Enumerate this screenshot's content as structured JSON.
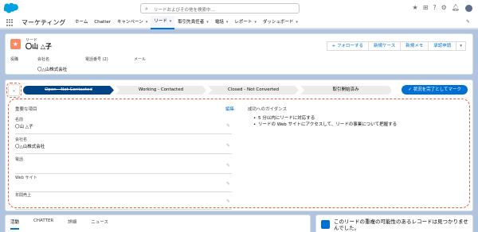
{
  "header": {
    "search_placeholder": "リードおよびその他を検索中..."
  },
  "nav": {
    "app_name": "マーケティング",
    "items": [
      {
        "label": "ホーム",
        "has_menu": false
      },
      {
        "label": "Chatter",
        "has_menu": false
      },
      {
        "label": "キャンペーン",
        "has_menu": true
      },
      {
        "label": "リード",
        "has_menu": true,
        "active": true
      },
      {
        "label": "取引先責任者",
        "has_menu": true
      },
      {
        "label": "電話",
        "has_menu": true
      },
      {
        "label": "レポート",
        "has_menu": true
      },
      {
        "label": "ダッシュボード",
        "has_menu": true
      }
    ]
  },
  "record": {
    "type_label": "リード",
    "name": "〇山 △子",
    "actions": [
      "+ フォローする",
      "新規ケース",
      "新規メモ",
      "承認申請"
    ],
    "highlights": {
      "title_label": "役職",
      "company_label": "会社名",
      "company_value": "〇△山株式会社",
      "phone_label": "電話番号 (2)",
      "email_label": "メール"
    }
  },
  "path": {
    "stages": [
      "Open - Not Contacted",
      "Working - Contacted",
      "Closed - Not Converted",
      "取引開始済み"
    ],
    "current_stage_index": 0,
    "mark_button": "✓ 状況を完了としてマーク"
  },
  "details": {
    "key_fields_title": "重要な項目",
    "edit_label": "編集",
    "guidance_title": "成功へのガイダンス",
    "fields": [
      {
        "label": "名前",
        "value": "〇山 △子"
      },
      {
        "label": "会社名",
        "value": "〇△山株式会社"
      },
      {
        "label": "電話",
        "value": ""
      },
      {
        "label": "Web サイト",
        "value": ""
      },
      {
        "label": "年間売上",
        "value": ""
      }
    ],
    "guidance": [
      "5 分以内にリードに対応する",
      "リードの Web サイトにアクセスして、リードの事業について把握する"
    ]
  },
  "tabs": [
    "活動",
    "CHATTER",
    "詳細",
    "ニュース"
  ],
  "duplicates": {
    "text": "このリードの重複の可能性のあるレコードは見つかりませんでした。"
  }
}
